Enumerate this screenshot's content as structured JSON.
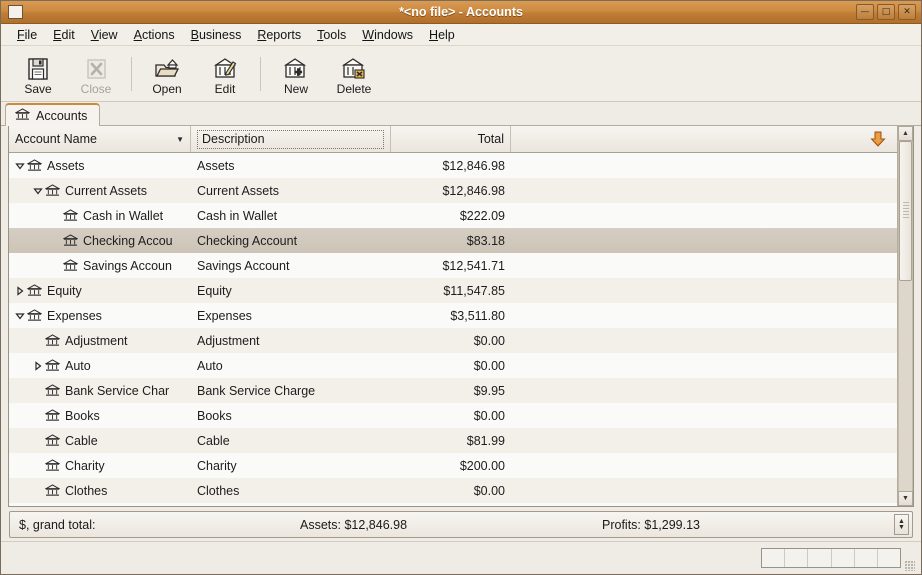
{
  "window": {
    "title": "*<no file> - Accounts",
    "buttons": {
      "minimize": "—",
      "maximize": "□",
      "close": "✕"
    }
  },
  "menubar": [
    {
      "label": "File",
      "mnemonic": "F"
    },
    {
      "label": "Edit",
      "mnemonic": "E"
    },
    {
      "label": "View",
      "mnemonic": "V"
    },
    {
      "label": "Actions",
      "mnemonic": "A"
    },
    {
      "label": "Business",
      "mnemonic": "B"
    },
    {
      "label": "Reports",
      "mnemonic": "R"
    },
    {
      "label": "Tools",
      "mnemonic": "T"
    },
    {
      "label": "Windows",
      "mnemonic": "W"
    },
    {
      "label": "Help",
      "mnemonic": "H"
    }
  ],
  "toolbar": [
    {
      "label": "Save",
      "icon": "floppy-disk-icon",
      "enabled": true
    },
    {
      "label": "Close",
      "icon": "close-x-icon",
      "enabled": false
    },
    {
      "label": "Open",
      "icon": "open-folder-icon",
      "enabled": true
    },
    {
      "label": "Edit",
      "icon": "edit-account-icon",
      "enabled": true
    },
    {
      "label": "New",
      "icon": "new-account-icon",
      "enabled": true
    },
    {
      "label": "Delete",
      "icon": "delete-account-icon",
      "enabled": true
    }
  ],
  "tabs": [
    {
      "label": "Accounts",
      "icon": "bank-icon",
      "active": true
    }
  ],
  "columns": {
    "account_name": "Account Name",
    "description": "Description",
    "total": "Total",
    "sort_indicator": "▼",
    "column-chooser": "down-arrow-icon"
  },
  "rows": [
    {
      "name": "Assets",
      "desc": "Assets",
      "total": "$12,846.98",
      "depth": 0,
      "expander": "expanded",
      "selected": false
    },
    {
      "name": "Current Assets",
      "desc": "Current Assets",
      "total": "$12,846.98",
      "depth": 1,
      "expander": "expanded",
      "selected": false
    },
    {
      "name": "Cash in Wallet",
      "desc": "Cash in Wallet",
      "total": "$222.09",
      "depth": 2,
      "expander": "none",
      "selected": false
    },
    {
      "name": "Checking Accou",
      "desc": "Checking Account",
      "total": "$83.18",
      "depth": 2,
      "expander": "none",
      "selected": true
    },
    {
      "name": "Savings Accoun",
      "desc": "Savings Account",
      "total": "$12,541.71",
      "depth": 2,
      "expander": "none",
      "selected": false
    },
    {
      "name": "Equity",
      "desc": "Equity",
      "total": "$11,547.85",
      "depth": 0,
      "expander": "collapsed",
      "selected": false
    },
    {
      "name": "Expenses",
      "desc": "Expenses",
      "total": "$3,511.80",
      "depth": 0,
      "expander": "expanded",
      "selected": false
    },
    {
      "name": "Adjustment",
      "desc": "Adjustment",
      "total": "$0.00",
      "depth": 1,
      "expander": "none",
      "selected": false
    },
    {
      "name": "Auto",
      "desc": "Auto",
      "total": "$0.00",
      "depth": 1,
      "expander": "collapsed",
      "selected": false
    },
    {
      "name": "Bank Service Char",
      "desc": "Bank Service Charge",
      "total": "$9.95",
      "depth": 1,
      "expander": "none",
      "selected": false
    },
    {
      "name": "Books",
      "desc": "Books",
      "total": "$0.00",
      "depth": 1,
      "expander": "none",
      "selected": false
    },
    {
      "name": "Cable",
      "desc": "Cable",
      "total": "$81.99",
      "depth": 1,
      "expander": "none",
      "selected": false
    },
    {
      "name": "Charity",
      "desc": "Charity",
      "total": "$200.00",
      "depth": 1,
      "expander": "none",
      "selected": false
    },
    {
      "name": "Clothes",
      "desc": "Clothes",
      "total": "$0.00",
      "depth": 1,
      "expander": "none",
      "selected": false
    }
  ],
  "summary": {
    "label": "$, grand total:",
    "assets": "Assets: $12,846.98",
    "profits": "Profits: $1,299.13",
    "spinner_up": "▲",
    "spinner_down": "▼"
  },
  "statusbar": {
    "progress_cells": 6
  },
  "colors": {
    "titlebar": "#c07d36",
    "accent": "#c98b3e",
    "selection": "#cdc4b7",
    "row_odd": "#fafaf8",
    "row_even": "#f3f0ea",
    "chrome": "#efebe5"
  }
}
